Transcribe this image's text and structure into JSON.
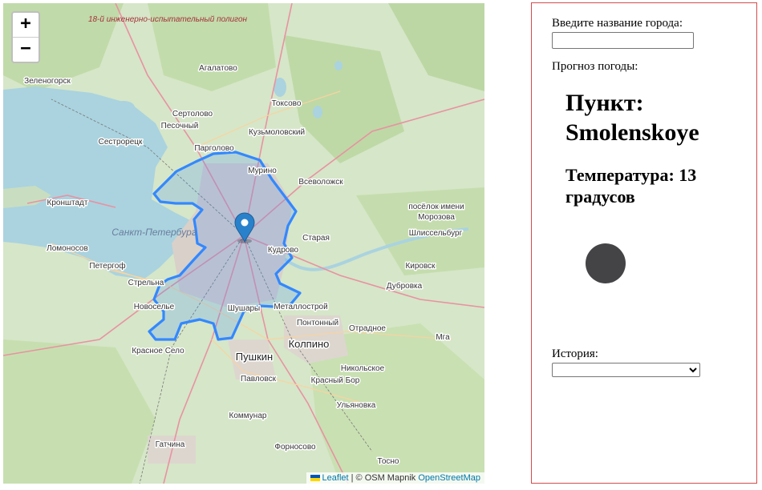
{
  "map": {
    "zoom_in": "+",
    "zoom_out": "−",
    "attribution": {
      "leaflet": "Leaflet",
      "separator": "| © OSM Mapnik",
      "osm": "OpenStreetMap"
    },
    "labels": {
      "polygon_range": "18-й инженерно-испытательный полигон",
      "agalatovo": "Агалатово",
      "zelenogorsk": "Зеленогорск",
      "toksovo": "Токсово",
      "sertolovo": "Сертолово",
      "pesochny": "Песочный",
      "kuzmolovsky": "Кузьмоловский",
      "sestroretsk": "Сестрорецк",
      "pargolovo": "Парголово",
      "murino": "Мурино",
      "vsevolozhsk": "Всеволожск",
      "kronshtadt": "Кронштадт",
      "spb": "Санкт-Петербург",
      "posyolok": "посёлок имени",
      "morozova": "Морозова",
      "staraya": "Старая",
      "shlisselburg": "Шлиссельбург",
      "lomonosov": "Ломоносов",
      "petergof": "Петергоф",
      "kudrovo": "Кудрово",
      "kirovsk": "Кировск",
      "strelna": "Стрельна",
      "dubrovka": "Дубровка",
      "novoselye": "Новоселье",
      "shushary": "Шушары",
      "metallostroy": "Металлострой",
      "pontonny": "Понтонный",
      "otradnoye": "Отрадное",
      "krasnoye_selo": "Красное Село",
      "kolpino": "Колпино",
      "mga": "Мга",
      "pushkin": "Пушкин",
      "nikolskoye": "Никольское",
      "pavlovsk": "Павловск",
      "krasny_bor": "Красный Бор",
      "ulyanovka": "Ульяновка",
      "kommunar": "Коммунар",
      "gatchina": "Гатчина",
      "fornosovo": "Форносово",
      "tosno": "Тосно"
    }
  },
  "panel": {
    "city_label": "Введите название города:",
    "city_value": "",
    "forecast_label": "Прогноз погоды:",
    "place_heading": "Пункт: Smolenskoye",
    "temperature_heading": "Температура: 13 градусов",
    "weather_icon": "dark-circle",
    "history_label": "История:",
    "history_selected": ""
  },
  "colors": {
    "panel_border": "#d24b4b",
    "boundary": "#3388ff",
    "marker": "#2a81cb",
    "water": "#aad3df",
    "land": "#d6e6c8"
  }
}
